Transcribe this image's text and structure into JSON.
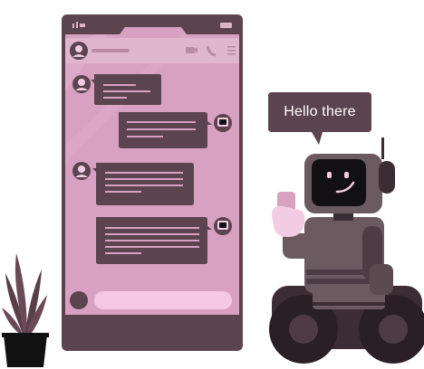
{
  "robot": {
    "speech_bubble": "Hello there"
  },
  "colors": {
    "phone_frame": "#5b434f",
    "screen": "#d8a1c2",
    "header_bar": "#e0b6cf",
    "chat_bubble": "#5b434f",
    "input_field": "#f7c7e6",
    "robot_body": "#6b5a60",
    "robot_dark": "#3b2d33",
    "robot_face_screen": "#121012",
    "plant": "#5a3e48"
  },
  "icons": {
    "header_avatar": "user-avatar-icon",
    "video": "video-camera-icon",
    "call": "phone-call-icon",
    "menu": "menu-lines-icon",
    "attach_button": "attach-circle-icon"
  }
}
